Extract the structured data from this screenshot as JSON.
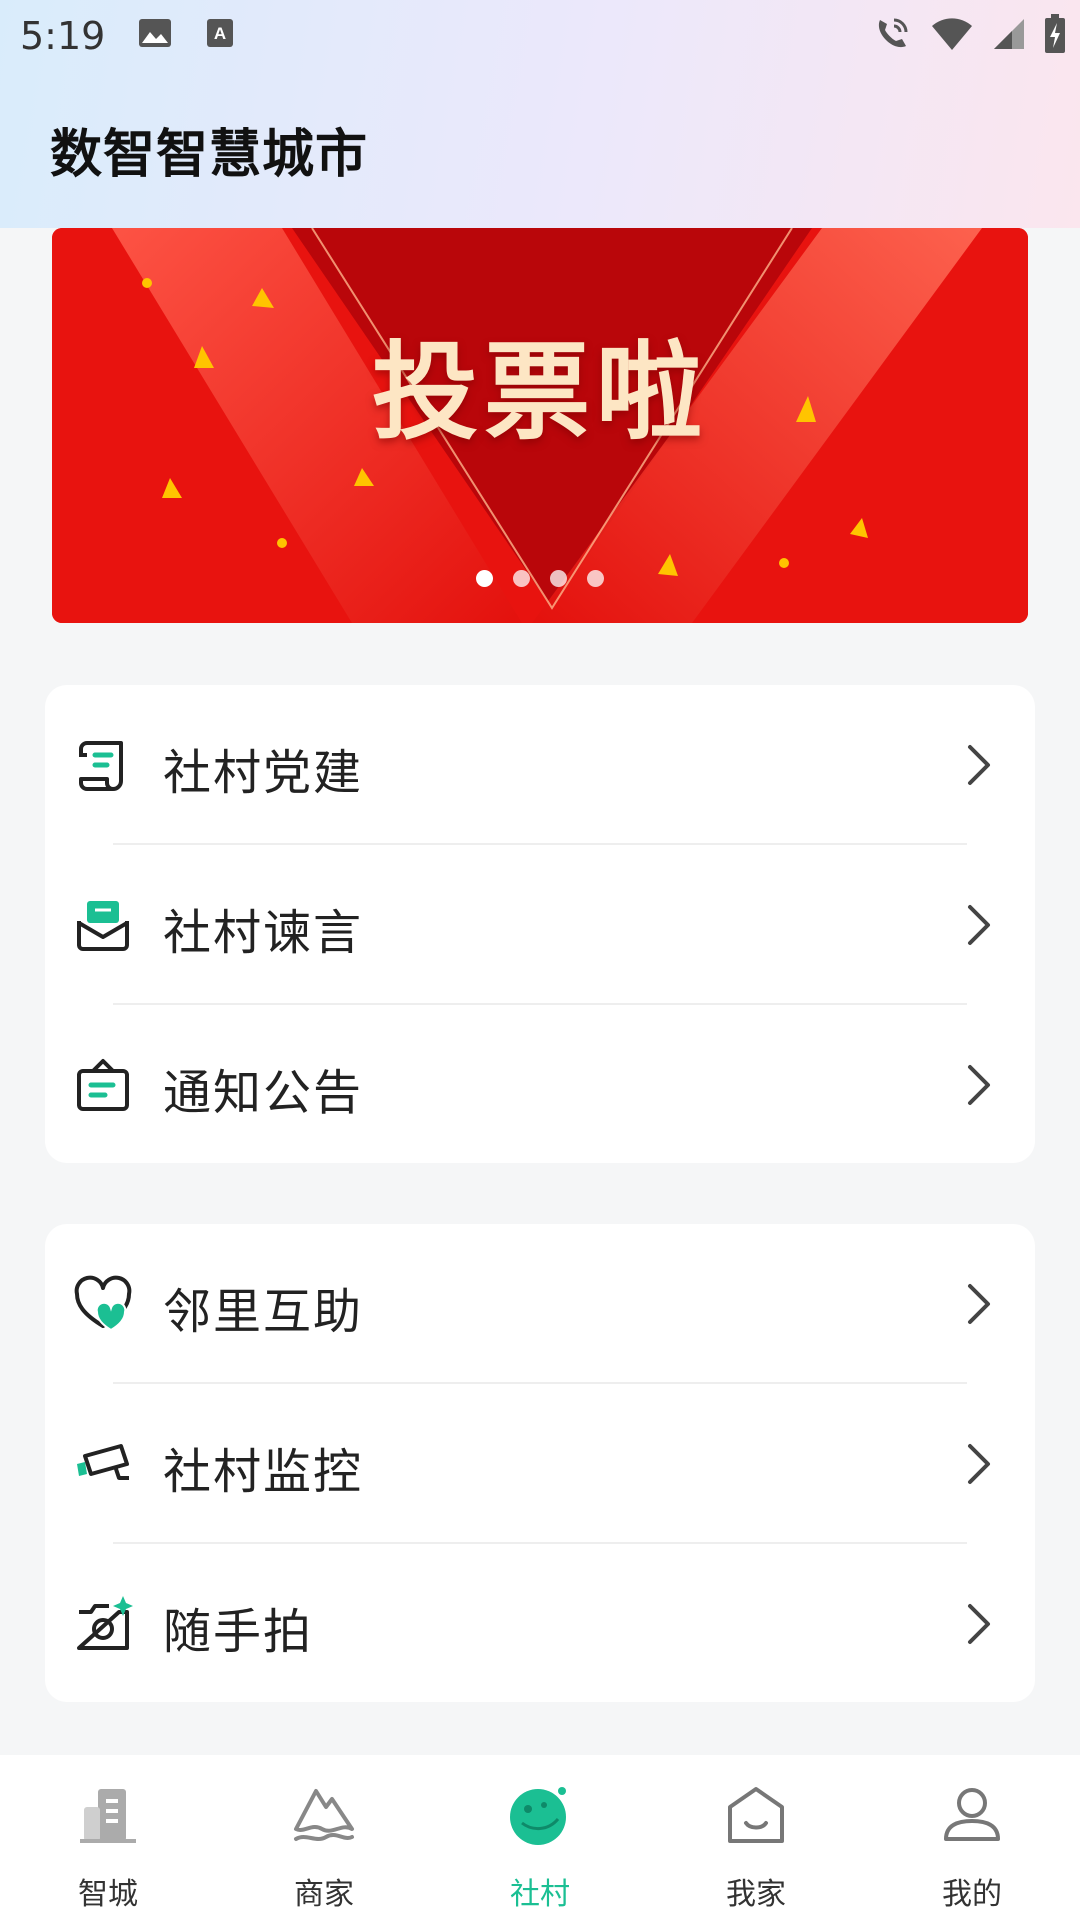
{
  "status_bar": {
    "time": "5:19"
  },
  "header": {
    "title": "数智智慧城市"
  },
  "banner": {
    "title": "投票啦",
    "slide_count": 4,
    "active_slide": 1
  },
  "card1": {
    "items": [
      {
        "label": "社村党建",
        "icon": "scroll-icon"
      },
      {
        "label": "社村谏言",
        "icon": "inbox-icon"
      },
      {
        "label": "通知公告",
        "icon": "notice-bag-icon"
      }
    ]
  },
  "card2": {
    "items": [
      {
        "label": "邻里互助",
        "icon": "heart-icon"
      },
      {
        "label": "社村监控",
        "icon": "camera-surveillance-icon"
      },
      {
        "label": "随手拍",
        "icon": "photo-camera-icon"
      }
    ]
  },
  "tabbar": {
    "items": [
      {
        "label": "智城",
        "icon": "building-icon"
      },
      {
        "label": "商家",
        "icon": "mountain-icon"
      },
      {
        "label": "社村",
        "icon": "planet-icon"
      },
      {
        "label": "我家",
        "icon": "home-icon"
      },
      {
        "label": "我的",
        "icon": "user-icon"
      }
    ],
    "active": "社村"
  },
  "colors": {
    "accent": "#1bbf93",
    "banner_red": "#e41a14"
  }
}
